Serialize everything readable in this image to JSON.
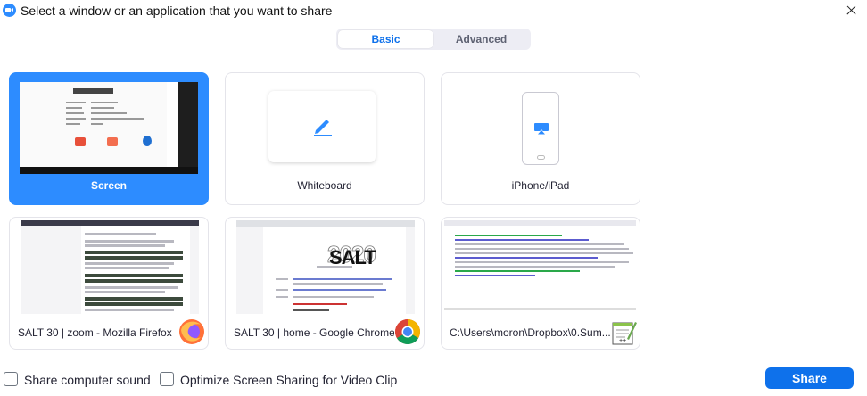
{
  "window": {
    "title": "Select a window or an application that you want to share"
  },
  "tabs": [
    {
      "label": "Basic",
      "active": true
    },
    {
      "label": "Advanced",
      "active": false
    }
  ],
  "tiles": {
    "screen": {
      "label": "Screen",
      "selected": true
    },
    "whiteboard": {
      "label": "Whiteboard"
    },
    "iphone": {
      "label": "iPhone/iPad"
    },
    "firefox": {
      "label": "SALT 30 | zoom - Mozilla Firefox",
      "icon": "firefox-icon"
    },
    "chrome": {
      "label": "SALT 30 | home - Google Chrome",
      "icon": "chrome-icon",
      "thumb_text": "SALT"
    },
    "notepad": {
      "label": "C:\\Users\\moron\\Dropbox\\0.Sum...",
      "icon": "notepad-plus-plus-icon"
    }
  },
  "options": {
    "share_sound": {
      "label": "Share computer sound",
      "checked": false
    },
    "optimize_video": {
      "label": "Optimize Screen Sharing for Video Clip",
      "checked": false
    }
  },
  "share_button": {
    "label": "Share"
  },
  "colors": {
    "accent": "#2D8CFF",
    "button": "#0E71EB",
    "tab_bg": "#EDEDF4"
  }
}
